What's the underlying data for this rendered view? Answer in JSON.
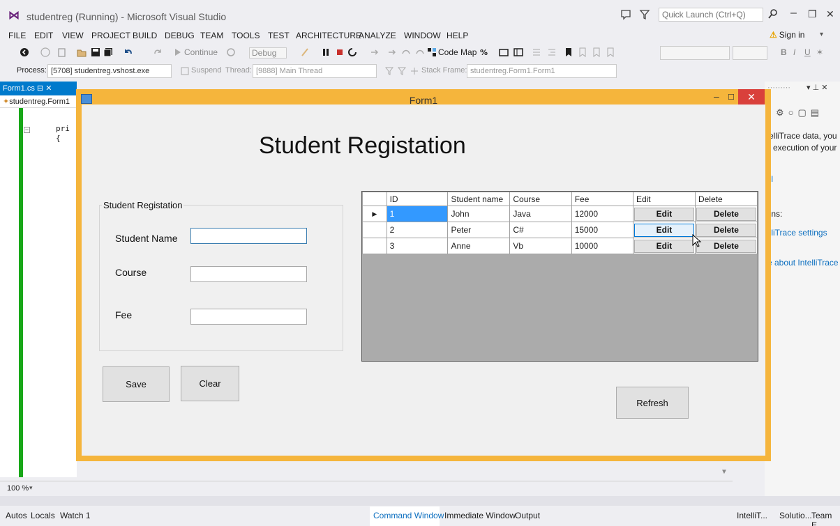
{
  "vs": {
    "title": "studentreg (Running) - Microsoft Visual Studio",
    "quick_launch_placeholder": "Quick Launch (Ctrl+Q)",
    "menu": [
      "FILE",
      "EDIT",
      "VIEW",
      "PROJECT",
      "BUILD",
      "DEBUG",
      "TEAM",
      "TOOLS",
      "TEST",
      "ARCHITECTURE",
      "ANALYZE",
      "WINDOW",
      "HELP"
    ],
    "sign_in": "Sign in",
    "toolbar": {
      "continue": "Continue",
      "config": "Debug",
      "code_map": "Code Map"
    },
    "debug_location": {
      "process_label": "Process:",
      "process_value": "[5708] studentreg.vshost.exe",
      "suspend": "Suspend",
      "thread_label": "Thread:",
      "thread_value": "[9888] Main Thread",
      "stack_frame_label": "Stack Frame:",
      "stack_frame_value": "studentreg.Form1.Form1"
    },
    "editor": {
      "tab": "Form1.cs",
      "nav": "studentreg.Form1",
      "lines": [
        "pri",
        "{"
      ],
      "zoom": "100 %"
    },
    "bottom_tabs_left": [
      "Autos",
      "Locals",
      "Watch 1"
    ],
    "bottom_tabs_mid": [
      "Command Window",
      "Immediate Window",
      "Output"
    ],
    "bottom_tabs_right": [
      "IntelliT...",
      "Solutio...",
      "Team E..."
    ],
    "intellitrace": {
      "text": "itelliTrace data, you\nik execution of your\nn.",
      "link_all": "all",
      "options_label": "ions:",
      "link_settings": "elliTrace settings",
      "link_about": "re about IntelliTrace"
    }
  },
  "form1": {
    "title": "Form1",
    "heading": "Student Registation",
    "group_title": "Student Registation",
    "labels": {
      "name": "Student Name",
      "course": "Course",
      "fee": "Fee"
    },
    "inputs": {
      "name": "",
      "course": "",
      "fee": ""
    },
    "buttons": {
      "save": "Save",
      "clear": "Clear",
      "refresh": "Refresh"
    },
    "grid": {
      "columns": [
        "ID",
        "Student name",
        "Course",
        "Fee",
        "Edit",
        "Delete"
      ],
      "rows": [
        {
          "id": "1",
          "name": "John",
          "course": "Java",
          "fee": "12000",
          "edit": "Edit",
          "delete": "Delete"
        },
        {
          "id": "2",
          "name": "Peter",
          "course": "C#",
          "fee": "15000",
          "edit": "Edit",
          "delete": "Delete"
        },
        {
          "id": "3",
          "name": "Anne",
          "course": "Vb",
          "fee": "10000",
          "edit": "Edit",
          "delete": "Delete"
        }
      ]
    }
  },
  "colors": {
    "form_border": "#f5b53c",
    "close_red": "#d9403b",
    "selection": "#3399ff",
    "vs_accent": "#007acc",
    "link": "#0e70c0"
  }
}
